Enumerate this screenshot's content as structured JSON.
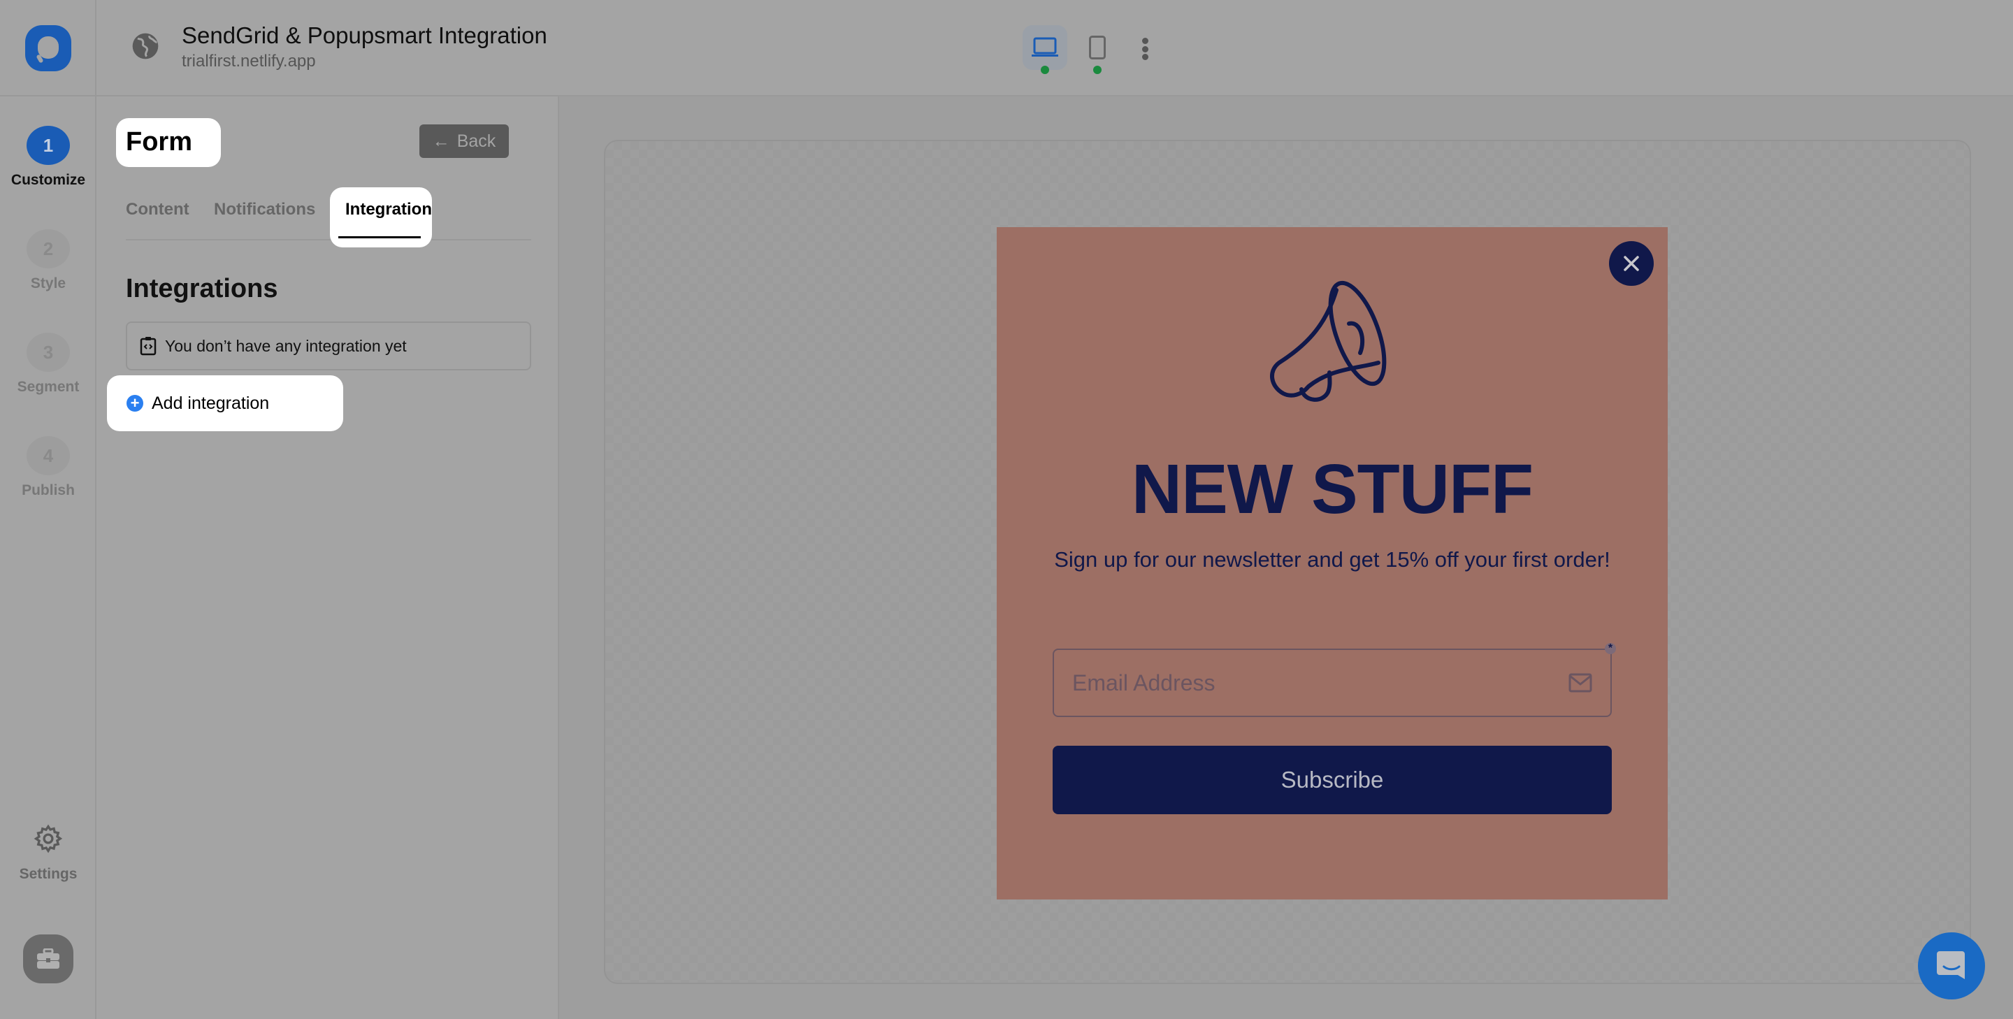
{
  "header": {
    "title": "SendGrid & Popupsmart Integration",
    "subtitle": "trialfirst.netlify.app",
    "devices": [
      {
        "name": "desktop",
        "active": true
      },
      {
        "name": "mobile",
        "active": false
      }
    ]
  },
  "rail": {
    "steps": [
      {
        "number": "1",
        "label": "Customize",
        "active": true
      },
      {
        "number": "2",
        "label": "Style",
        "active": false
      },
      {
        "number": "3",
        "label": "Segment",
        "active": false
      },
      {
        "number": "4",
        "label": "Publish",
        "active": false
      }
    ],
    "settings_label": "Settings"
  },
  "panel": {
    "title": "Form",
    "back_label": "Back",
    "tabs": [
      {
        "label": "Content",
        "active": false
      },
      {
        "label": "Notifications",
        "active": false
      },
      {
        "label": "Integration",
        "active": true
      }
    ],
    "section_title": "Integrations",
    "empty_message": "You don’t have any integration yet",
    "add_label": "Add integration"
  },
  "popup": {
    "headline": "NEW STUFF",
    "description": "Sign up for our newsletter and get 15% off your first order!",
    "email_placeholder": "Email Address",
    "required_marker": "*",
    "subscribe_label": "Subscribe",
    "background_color": "#9d6f64",
    "accent_color": "#10184a"
  },
  "colors": {
    "brand": "#1a5cb5",
    "status_online": "#1a8a3e",
    "add_icon": "#2a7ff0"
  }
}
